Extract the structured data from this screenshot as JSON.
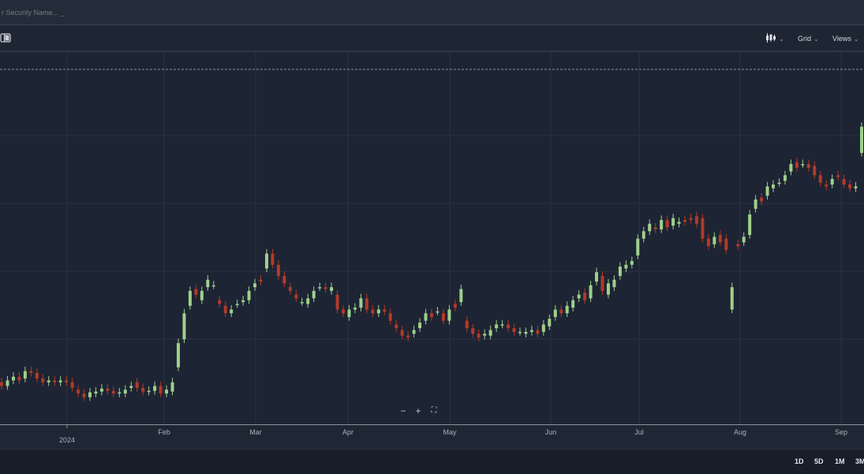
{
  "search": {
    "placeholder": "r Security Name... _"
  },
  "toolbar": {
    "grid_label": "Grid",
    "views_label": "Views"
  },
  "periods": [
    "1D",
    "5D",
    "1M",
    "3M"
  ],
  "colors": {
    "up": "#9ed08c",
    "down": "#b23a2a",
    "grid": "#2a3242",
    "background": "#1d2433"
  },
  "icons": {
    "panel": "panel-toggle-icon",
    "chart_type": "candlestick-icon",
    "zoom_out": "minus-icon",
    "zoom_in": "plus-icon",
    "fit": "fit-screen-icon"
  },
  "chart_data": {
    "type": "candlestick",
    "x_axis_labels": [
      "2024",
      "Feb",
      "Mar",
      "Apr",
      "May",
      "Jun",
      "Jul",
      "Aug",
      "Sep"
    ],
    "grid": true,
    "reference_line": "dashed horizontal line near top",
    "candles": [
      {
        "o": 0.135,
        "c": 0.125
      },
      {
        "o": 0.125,
        "c": 0.14
      },
      {
        "o": 0.14,
        "c": 0.15
      },
      {
        "o": 0.15,
        "c": 0.14
      },
      {
        "o": 0.145,
        "c": 0.165
      },
      {
        "o": 0.165,
        "c": 0.16
      },
      {
        "o": 0.16,
        "c": 0.145
      },
      {
        "o": 0.145,
        "c": 0.135
      },
      {
        "o": 0.135,
        "c": 0.14
      },
      {
        "o": 0.14,
        "c": 0.135
      },
      {
        "o": 0.135,
        "c": 0.14
      },
      {
        "o": 0.14,
        "c": 0.135
      },
      {
        "o": 0.135,
        "c": 0.12
      },
      {
        "o": 0.115,
        "c": 0.105
      },
      {
        "o": 0.105,
        "c": 0.095
      },
      {
        "o": 0.095,
        "c": 0.108
      },
      {
        "o": 0.105,
        "c": 0.11
      },
      {
        "o": 0.11,
        "c": 0.118
      },
      {
        "o": 0.118,
        "c": 0.112
      },
      {
        "o": 0.112,
        "c": 0.105
      },
      {
        "o": 0.105,
        "c": 0.108
      },
      {
        "o": 0.105,
        "c": 0.115
      },
      {
        "o": 0.12,
        "c": 0.125
      },
      {
        "o": 0.135,
        "c": 0.12
      },
      {
        "o": 0.12,
        "c": 0.11
      },
      {
        "o": 0.11,
        "c": 0.112
      },
      {
        "o": 0.112,
        "c": 0.125
      },
      {
        "o": 0.125,
        "c": 0.105
      },
      {
        "o": 0.105,
        "c": 0.115
      },
      {
        "o": 0.11,
        "c": 0.135
      },
      {
        "o": 0.175,
        "c": 0.24
      },
      {
        "o": 0.25,
        "c": 0.32
      },
      {
        "o": 0.34,
        "c": 0.38
      },
      {
        "o": 0.385,
        "c": 0.37
      },
      {
        "o": 0.355,
        "c": 0.38
      },
      {
        "o": 0.39,
        "c": 0.41
      },
      {
        "o": 0.395,
        "c": 0.395
      },
      {
        "o": 0.355,
        "c": 0.345
      },
      {
        "o": 0.34,
        "c": 0.32
      },
      {
        "o": 0.32,
        "c": 0.33
      },
      {
        "o": 0.345,
        "c": 0.345
      },
      {
        "o": 0.35,
        "c": 0.355
      },
      {
        "o": 0.355,
        "c": 0.38
      },
      {
        "o": 0.39,
        "c": 0.4
      },
      {
        "o": 0.41,
        "c": 0.405
      },
      {
        "o": 0.44,
        "c": 0.48
      },
      {
        "o": 0.48,
        "c": 0.45
      },
      {
        "o": 0.45,
        "c": 0.42
      },
      {
        "o": 0.42,
        "c": 0.4
      },
      {
        "o": 0.39,
        "c": 0.38
      },
      {
        "o": 0.37,
        "c": 0.36
      },
      {
        "o": 0.35,
        "c": 0.35
      },
      {
        "o": 0.345,
        "c": 0.36
      },
      {
        "o": 0.36,
        "c": 0.38
      },
      {
        "o": 0.39,
        "c": 0.39
      },
      {
        "o": 0.39,
        "c": 0.385
      },
      {
        "o": 0.38,
        "c": 0.39
      },
      {
        "o": 0.37,
        "c": 0.33
      },
      {
        "o": 0.33,
        "c": 0.32
      },
      {
        "o": 0.31,
        "c": 0.33
      },
      {
        "o": 0.33,
        "c": 0.335
      },
      {
        "o": 0.335,
        "c": 0.36
      },
      {
        "o": 0.36,
        "c": 0.33
      },
      {
        "o": 0.33,
        "c": 0.32
      },
      {
        "o": 0.32,
        "c": 0.33
      },
      {
        "o": 0.33,
        "c": 0.325
      },
      {
        "o": 0.32,
        "c": 0.3
      },
      {
        "o": 0.29,
        "c": 0.28
      },
      {
        "o": 0.275,
        "c": 0.26
      },
      {
        "o": 0.26,
        "c": 0.255
      },
      {
        "o": 0.265,
        "c": 0.275
      },
      {
        "o": 0.28,
        "c": 0.295
      },
      {
        "o": 0.3,
        "c": 0.32
      },
      {
        "o": 0.32,
        "c": 0.31
      },
      {
        "o": 0.325,
        "c": 0.325
      },
      {
        "o": 0.32,
        "c": 0.3
      },
      {
        "o": 0.3,
        "c": 0.33
      },
      {
        "o": 0.345,
        "c": 0.335
      },
      {
        "o": 0.35,
        "c": 0.385
      },
      {
        "o": 0.3,
        "c": 0.28
      },
      {
        "o": 0.28,
        "c": 0.265
      },
      {
        "o": 0.265,
        "c": 0.255
      },
      {
        "o": 0.26,
        "c": 0.265
      },
      {
        "o": 0.26,
        "c": 0.275
      },
      {
        "o": 0.28,
        "c": 0.29
      },
      {
        "o": 0.29,
        "c": 0.29
      },
      {
        "o": 0.29,
        "c": 0.28
      },
      {
        "o": 0.28,
        "c": 0.27
      },
      {
        "o": 0.27,
        "c": 0.27
      },
      {
        "o": 0.265,
        "c": 0.27
      },
      {
        "o": 0.27,
        "c": 0.275
      },
      {
        "o": 0.275,
        "c": 0.265
      },
      {
        "o": 0.27,
        "c": 0.29
      },
      {
        "o": 0.285,
        "c": 0.305
      },
      {
        "o": 0.31,
        "c": 0.33
      },
      {
        "o": 0.33,
        "c": 0.32
      },
      {
        "o": 0.32,
        "c": 0.34
      },
      {
        "o": 0.335,
        "c": 0.355
      },
      {
        "o": 0.36,
        "c": 0.37
      },
      {
        "o": 0.375,
        "c": 0.355
      },
      {
        "o": 0.36,
        "c": 0.395
      },
      {
        "o": 0.405,
        "c": 0.43
      },
      {
        "o": 0.42,
        "c": 0.38
      },
      {
        "o": 0.37,
        "c": 0.4
      },
      {
        "o": 0.39,
        "c": 0.41
      },
      {
        "o": 0.42,
        "c": 0.445
      },
      {
        "o": 0.44,
        "c": 0.45
      },
      {
        "o": 0.45,
        "c": 0.46
      },
      {
        "o": 0.475,
        "c": 0.52
      },
      {
        "o": 0.52,
        "c": 0.54
      },
      {
        "o": 0.54,
        "c": 0.56
      },
      {
        "o": 0.55,
        "c": 0.545
      },
      {
        "o": 0.545,
        "c": 0.57
      },
      {
        "o": 0.57,
        "c": 0.55
      },
      {
        "o": 0.555,
        "c": 0.575
      },
      {
        "o": 0.56,
        "c": 0.565
      },
      {
        "o": 0.57,
        "c": 0.565
      },
      {
        "o": 0.575,
        "c": 0.57
      },
      {
        "o": 0.58,
        "c": 0.56
      },
      {
        "o": 0.575,
        "c": 0.52
      },
      {
        "o": 0.52,
        "c": 0.5
      },
      {
        "o": 0.505,
        "c": 0.525
      },
      {
        "o": 0.53,
        "c": 0.51
      },
      {
        "o": 0.52,
        "c": 0.49
      },
      {
        "o": 0.33,
        "c": 0.39
      },
      {
        "o": 0.505,
        "c": 0.5
      },
      {
        "o": 0.51,
        "c": 0.525
      },
      {
        "o": 0.53,
        "c": 0.585
      },
      {
        "o": 0.6,
        "c": 0.625
      },
      {
        "o": 0.63,
        "c": 0.62
      },
      {
        "o": 0.635,
        "c": 0.66
      },
      {
        "o": 0.655,
        "c": 0.665
      },
      {
        "o": 0.67,
        "c": 0.67
      },
      {
        "o": 0.675,
        "c": 0.69
      },
      {
        "o": 0.7,
        "c": 0.72
      },
      {
        "o": 0.725,
        "c": 0.71
      },
      {
        "o": 0.72,
        "c": 0.72
      },
      {
        "o": 0.72,
        "c": 0.71
      },
      {
        "o": 0.715,
        "c": 0.69
      },
      {
        "o": 0.69,
        "c": 0.67
      },
      {
        "o": 0.665,
        "c": 0.66
      },
      {
        "o": 0.665,
        "c": 0.68
      },
      {
        "o": 0.69,
        "c": 0.685
      },
      {
        "o": 0.68,
        "c": 0.665
      },
      {
        "o": 0.665,
        "c": 0.655
      },
      {
        "o": 0.655,
        "c": 0.66
      },
      {
        "o": 0.75,
        "c": 0.82
      }
    ]
  }
}
